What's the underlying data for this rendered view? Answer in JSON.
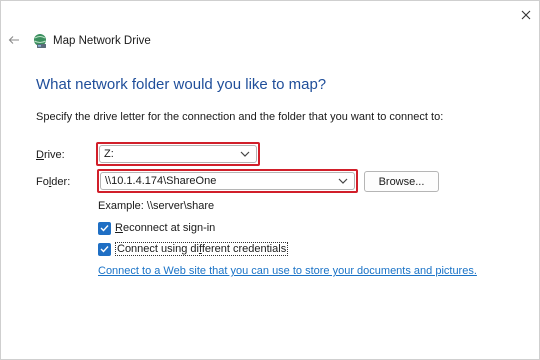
{
  "window": {
    "title": "Map Network Drive",
    "icon": "network-drive-icon",
    "close_icon": "close-icon",
    "back_icon": "back-arrow-icon"
  },
  "main": {
    "heading": "What network folder would you like to map?",
    "instruction": "Specify the drive letter for the connection and the folder that you want to connect to:",
    "drive": {
      "label_pre": "",
      "label_accel": "D",
      "label_post": "rive:",
      "value": "Z:"
    },
    "folder": {
      "label_pre": "Fo",
      "label_accel": "l",
      "label_post": "der:",
      "value": "\\\\10.1.4.174\\ShareOne"
    },
    "browse_label": "Browse...",
    "example": "Example: \\\\server\\share",
    "reconnect": {
      "accel": "R",
      "rest": "econnect at sign-in",
      "checked": true
    },
    "credentials": {
      "pre": "Connect using di",
      "accel": "f",
      "rest": "ferent credentials",
      "checked": true
    },
    "link": "Connect to a Web site that you can use to store your documents and pictures."
  },
  "colors": {
    "heading": "#1f4e9a",
    "highlight": "#d11f2a",
    "checkbox": "#1f6fc4",
    "link": "#1a73c7"
  }
}
